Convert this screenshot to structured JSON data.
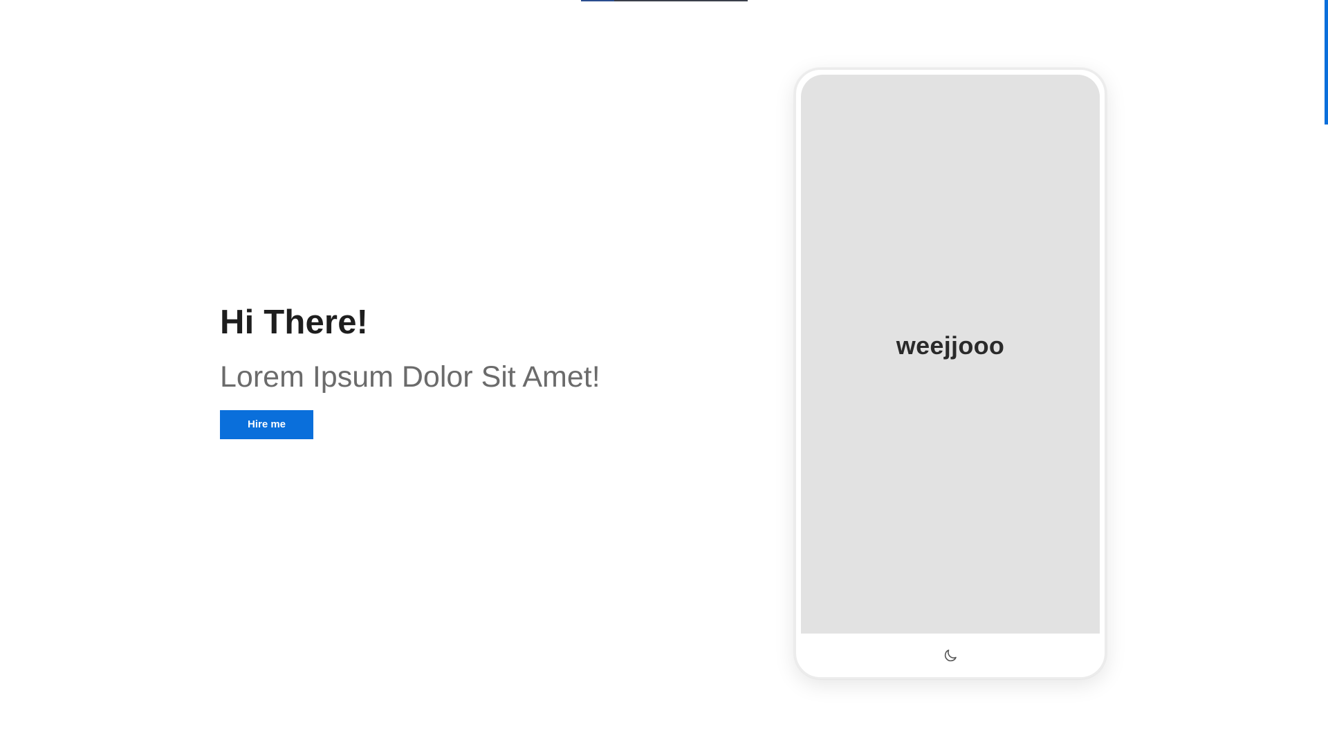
{
  "hero": {
    "title": "Hi There!",
    "subtitle": "Lorem Ipsum Dolor Sit Amet!",
    "cta_label": "Hire me"
  },
  "phone": {
    "brand_name": "weejjooo",
    "bottom_icon": "moon-icon"
  },
  "colors": {
    "accent": "#0a6fdb",
    "title": "#1e1e1e",
    "subtitle": "#6b6b6b",
    "screen": "#e2e2e2"
  }
}
